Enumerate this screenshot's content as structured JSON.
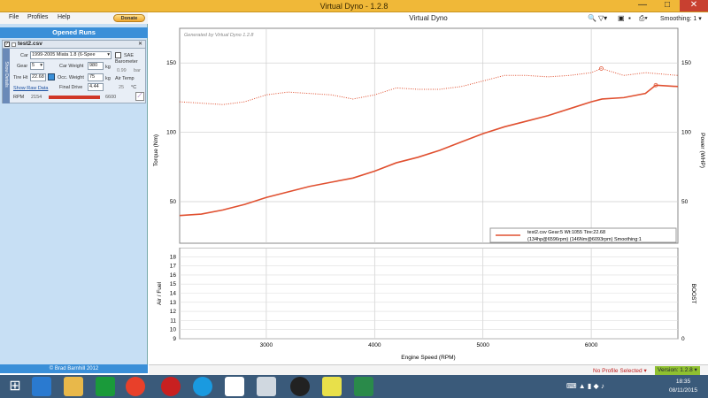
{
  "window": {
    "title": "Virtual Dyno - 1.2.8",
    "minimize": "—",
    "maximize": "□",
    "close": "✕"
  },
  "menu": {
    "file": "File",
    "profiles": "Profiles",
    "help": "Help",
    "donate": "Donate"
  },
  "sidebar": {
    "header": "Opened Runs",
    "run": {
      "filename": "test2.csv",
      "vertical_tab": "Show Details",
      "car_label": "Car",
      "car_value": "1999-2005 Miata 1.8 (6-Spee",
      "sae_label": "SAE",
      "gear_label": "Gear",
      "gear_value": "5",
      "car_weight_label": "Car Weight",
      "car_weight_value": "980",
      "car_weight_unit": "kg",
      "barometer_label": "Barometer",
      "barometer_value": "0.99",
      "barometer_unit": "bar",
      "tire_label": "Tire Ht",
      "tire_value": "22.68",
      "occ_weight_label": "Occ. Weight",
      "occ_weight_value": "75",
      "occ_weight_unit": "kg",
      "air_temp_label": "Air Temp",
      "air_temp_value": "25",
      "air_temp_unit": "°C",
      "final_drive_label": "Final Drive",
      "final_drive_value": "4.44",
      "raw_data_link": "Show Raw Data",
      "rpm_label": "RPM",
      "rpm_min": "2154",
      "rpm_max": "6600"
    },
    "credit": "© Brad Barnhill 2012"
  },
  "toolbar": {
    "smoothing_label": "Smoothing: 1"
  },
  "chart_data": [
    {
      "type": "line",
      "title": "Virtual Dyno",
      "watermark": "Generated by Virtual Dyno 1.2.8",
      "xlabel": "Engine Speed (RPM)",
      "ylabel": "Torque (Nm)",
      "y2label": "Power (WHP)",
      "xlim": [
        2200,
        6800
      ],
      "ylim": [
        20,
        175
      ],
      "xticks": [
        3000,
        4000,
        5000,
        6000
      ],
      "yticks": [
        50,
        100,
        150
      ],
      "y2ticks": [
        50,
        100,
        150
      ],
      "grid": true,
      "series": [
        {
          "role": "power",
          "style": "solid",
          "x": [
            2200,
            2400,
            2600,
            2800,
            3000,
            3200,
            3400,
            3600,
            3800,
            4000,
            4200,
            4400,
            4600,
            4800,
            5000,
            5200,
            5400,
            5600,
            5800,
            6000,
            6100,
            6300,
            6500,
            6596,
            6800
          ],
          "values": [
            40,
            41,
            44,
            48,
            53,
            57,
            61,
            64,
            67,
            72,
            78,
            82,
            87,
            93,
            99,
            104,
            108,
            112,
            117,
            122,
            124,
            125,
            128,
            134,
            133
          ]
        },
        {
          "role": "torque",
          "style": "dotted",
          "x": [
            2200,
            2400,
            2600,
            2800,
            3000,
            3200,
            3400,
            3600,
            3800,
            4000,
            4200,
            4400,
            4600,
            4800,
            5000,
            5200,
            5400,
            5600,
            5800,
            6000,
            6093,
            6300,
            6500,
            6800
          ],
          "values": [
            122,
            121,
            120,
            122,
            127,
            129,
            128,
            127,
            124,
            127,
            132,
            131,
            131,
            133,
            137,
            141,
            141,
            140,
            141,
            143,
            146,
            141,
            143,
            141
          ]
        }
      ],
      "markers": [
        {
          "x": 6093,
          "y": 146
        },
        {
          "x": 6596,
          "y": 134
        }
      ],
      "legend": {
        "placement": "bottom-right",
        "line1": "test2.csv Gear:5 Wt:1055 Tire:22.68",
        "line2": "(134hp@6596rpm) (146Nm@6093rpm) Smoothing:1"
      }
    },
    {
      "type": "line",
      "ylabel": "Air / Fuel",
      "y2label": "BOOST",
      "ylim": [
        9,
        19
      ],
      "yticks": [
        9,
        10,
        11,
        12,
        13,
        14,
        15,
        16,
        17,
        18
      ],
      "y2ticks": [
        0
      ],
      "grid": true,
      "series": []
    }
  ],
  "status": {
    "profile": "No Profile Selected",
    "version": "Version: 1.2.8"
  },
  "taskbar": {
    "time": "18:35",
    "date": "08/11/2015"
  },
  "colors": {
    "accent": "#3a8fd8",
    "title": "#f0b838",
    "series": "#e05030"
  }
}
